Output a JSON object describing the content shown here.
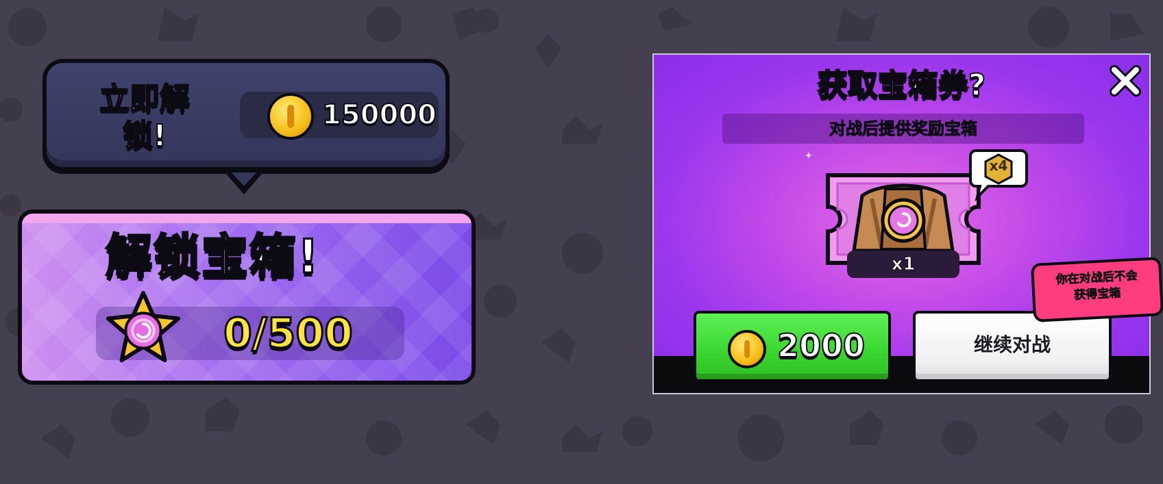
{
  "background": {
    "color": "#45404f",
    "pattern_color": "#3b3644"
  },
  "unlock_now": {
    "label": "立即解锁!",
    "price": "150000",
    "coin_icon": "coin-icon"
  },
  "unlock_chest": {
    "title": "解锁宝箱!",
    "progress_text": "0/500",
    "progress": {
      "current": 0,
      "max": 500
    },
    "star_icon": "star-icon"
  },
  "popup": {
    "title": "获取宝箱券?",
    "subtitle_prefix": "对战后提供",
    "subtitle_highlight": "奖励宝箱",
    "ticket_count": "x1",
    "bonus_multiplier": "x4",
    "buy_price": "2000",
    "continue_label": "继续对战",
    "warning_line1": "你在对战后不会",
    "warning_line2_prefix": "获得",
    "warning_line2_highlight": "宝箱",
    "colors": {
      "purple": "#9a36ee",
      "magenta": "#e66ae8",
      "green_button": "#3ad52f",
      "highlight_pink": "#ff6fd8",
      "warning_pink": "#ff3c7d",
      "gold": "#ffe340"
    }
  }
}
